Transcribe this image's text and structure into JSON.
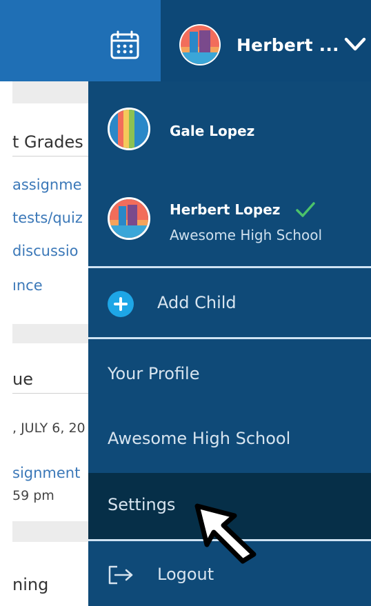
{
  "topbar": {
    "user_name": "Herbert ...",
    "calendar_icon": "calendar-icon",
    "chevron_icon": "chevron-down-icon"
  },
  "background_page": {
    "card1": {
      "heading": "t Grades",
      "links": [
        "assignme",
        "tests/quiz",
        "discussio",
        "ınce"
      ]
    },
    "card2": {
      "heading": "ue",
      "date": ", JULY 6, 20",
      "assignment": "signment",
      "time": "59 pm"
    },
    "card3": {
      "heading": "ning"
    }
  },
  "menu": {
    "children": [
      {
        "name": "Gale Lopez",
        "school": "",
        "selected": false
      },
      {
        "name": "Herbert Lopez",
        "school": "Awesome High School",
        "selected": true
      }
    ],
    "add_child": "Add Child",
    "your_profile": "Your Profile",
    "school": "Awesome High School",
    "settings": "Settings",
    "logout": "Logout"
  },
  "colors": {
    "topbar_blue": "#1f6fb5",
    "menu_navy": "#0f4a78",
    "settings_hover": "#062f48",
    "check_green": "#4cc36a",
    "add_blue": "#1ea6e6"
  }
}
